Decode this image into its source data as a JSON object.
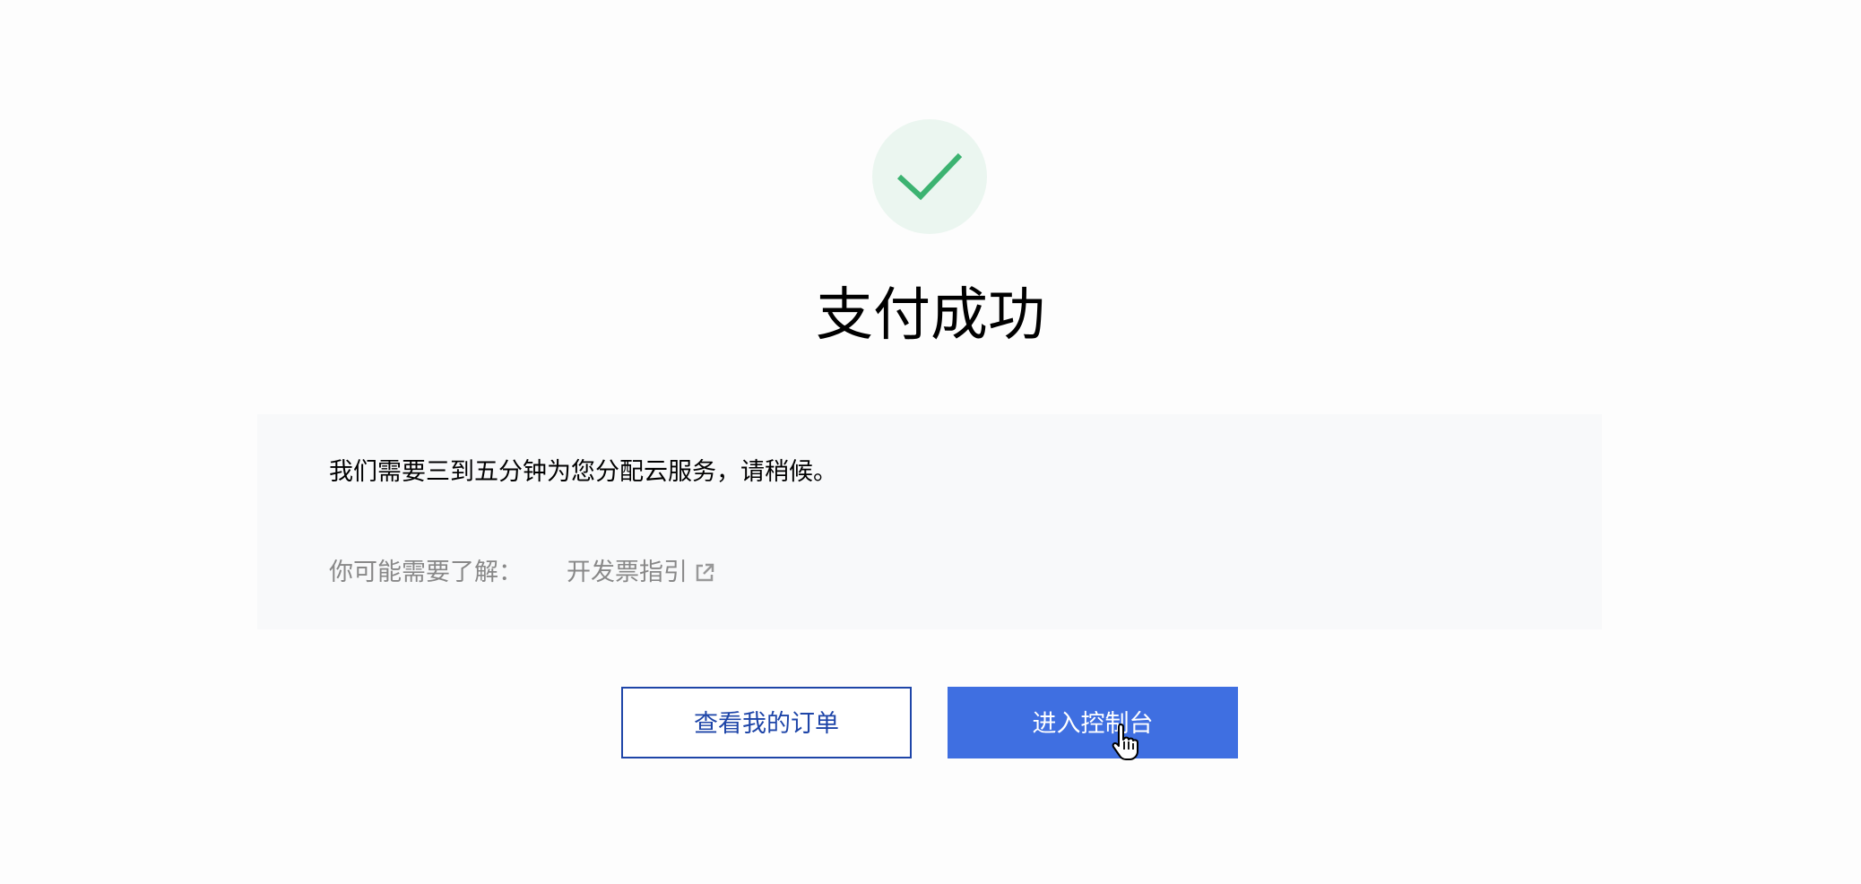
{
  "status": {
    "icon": "check-icon",
    "title": "支付成功",
    "accent_color": "#3cb371"
  },
  "info": {
    "message": "我们需要三到五分钟为您分配云服务，请稍候。",
    "hint_label": "你可能需要了解：",
    "links": [
      {
        "label": "开发票指引",
        "icon": "external-link-icon"
      }
    ]
  },
  "actions": {
    "view_orders": "查看我的订单",
    "enter_console": "进入控制台",
    "primary_color": "#3f6fe1",
    "secondary_color": "#1e45a8"
  },
  "cursor": {
    "icon": "hand-pointer-icon"
  }
}
